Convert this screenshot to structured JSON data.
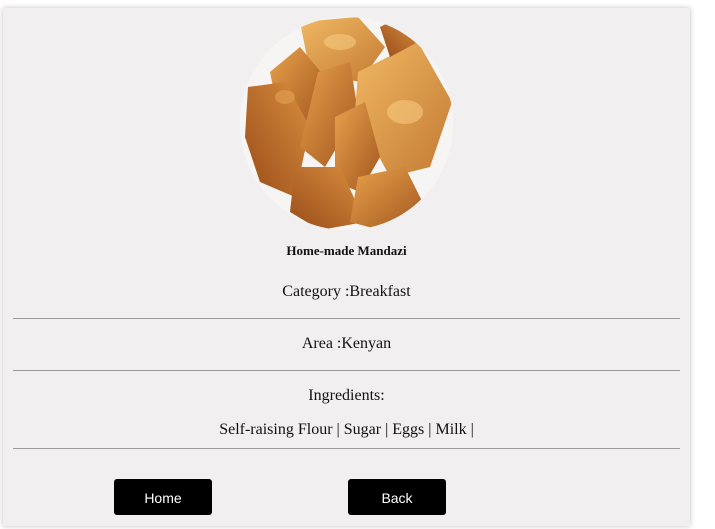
{
  "recipe": {
    "title": "Home-made Mandazi",
    "category_label": "Category :",
    "category": "Breakfast",
    "area_label": "Area :",
    "area": "Kenyan",
    "ingredients_label": "Ingredients:",
    "ingredients": [
      "Self-raising Flour",
      "Sugar",
      "Eggs",
      "Milk"
    ],
    "ingredient_separator": " | "
  },
  "buttons": {
    "home": "Home",
    "back": "Back"
  },
  "colors": {
    "card_background": "#f1efef",
    "button_background": "#000000",
    "button_text": "#ffffff"
  }
}
